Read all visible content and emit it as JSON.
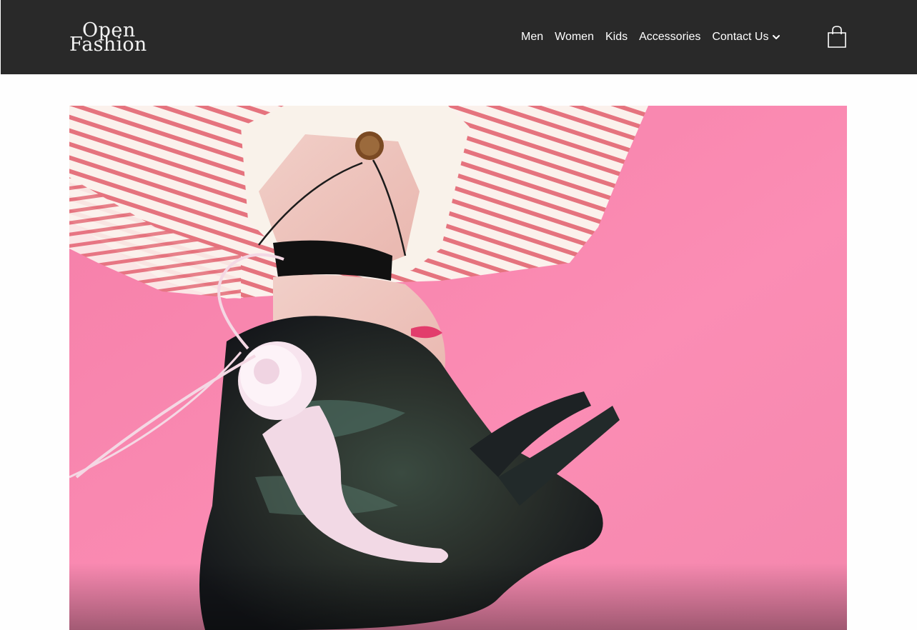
{
  "brand": {
    "logo_line1": "Open",
    "logo_line2": "Fashion"
  },
  "nav": {
    "items": [
      {
        "label": "Men"
      },
      {
        "label": "Women"
      },
      {
        "label": "Kids"
      },
      {
        "label": "Accessories"
      },
      {
        "label": "Contact Us",
        "has_dropdown": true
      }
    ]
  },
  "cart": {
    "icon": "shopping-bag-icon"
  },
  "hero": {
    "description_icon": "hero-photo"
  },
  "colors": {
    "header_bg": "#292929",
    "page_bg": "#fefefe",
    "hero_pink": "#f98ab1",
    "stripe_red": "#e66f7b"
  }
}
